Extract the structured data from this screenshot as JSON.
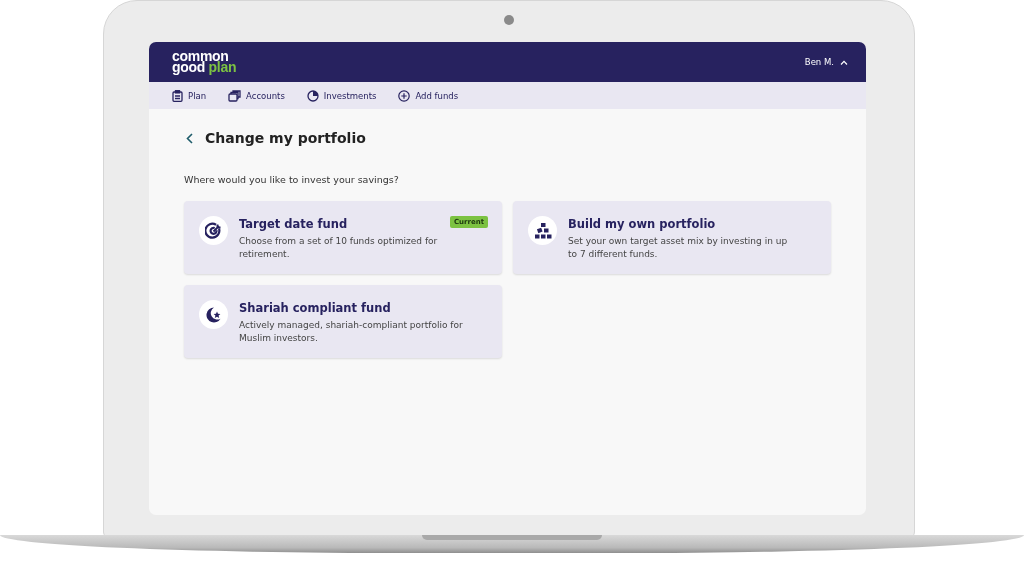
{
  "header": {
    "logo": {
      "line1": "common",
      "line2": "good",
      "accent": "plan"
    },
    "user": "Ben M."
  },
  "nav": [
    {
      "label": "Plan",
      "kind": "clipboard"
    },
    {
      "label": "Accounts",
      "kind": "stack"
    },
    {
      "label": "Investments",
      "kind": "pie"
    },
    {
      "label": "Add funds",
      "kind": "plus"
    }
  ],
  "page": {
    "title": "Change my portfolio",
    "question": "Where would you like to invest your savings?"
  },
  "options": [
    {
      "kind": "target",
      "title": "Target date fund",
      "description": "Choose from a set of 10 funds optimized for retirement.",
      "badge": "Current"
    },
    {
      "kind": "blocks",
      "title": "Build my own portfolio",
      "description": "Set your own target asset mix by investing in up to 7 different funds."
    },
    {
      "kind": "crescent",
      "title": "Shariah compliant fund",
      "description": "Actively managed, shariah-compliant portfolio for Muslim investors."
    }
  ]
}
